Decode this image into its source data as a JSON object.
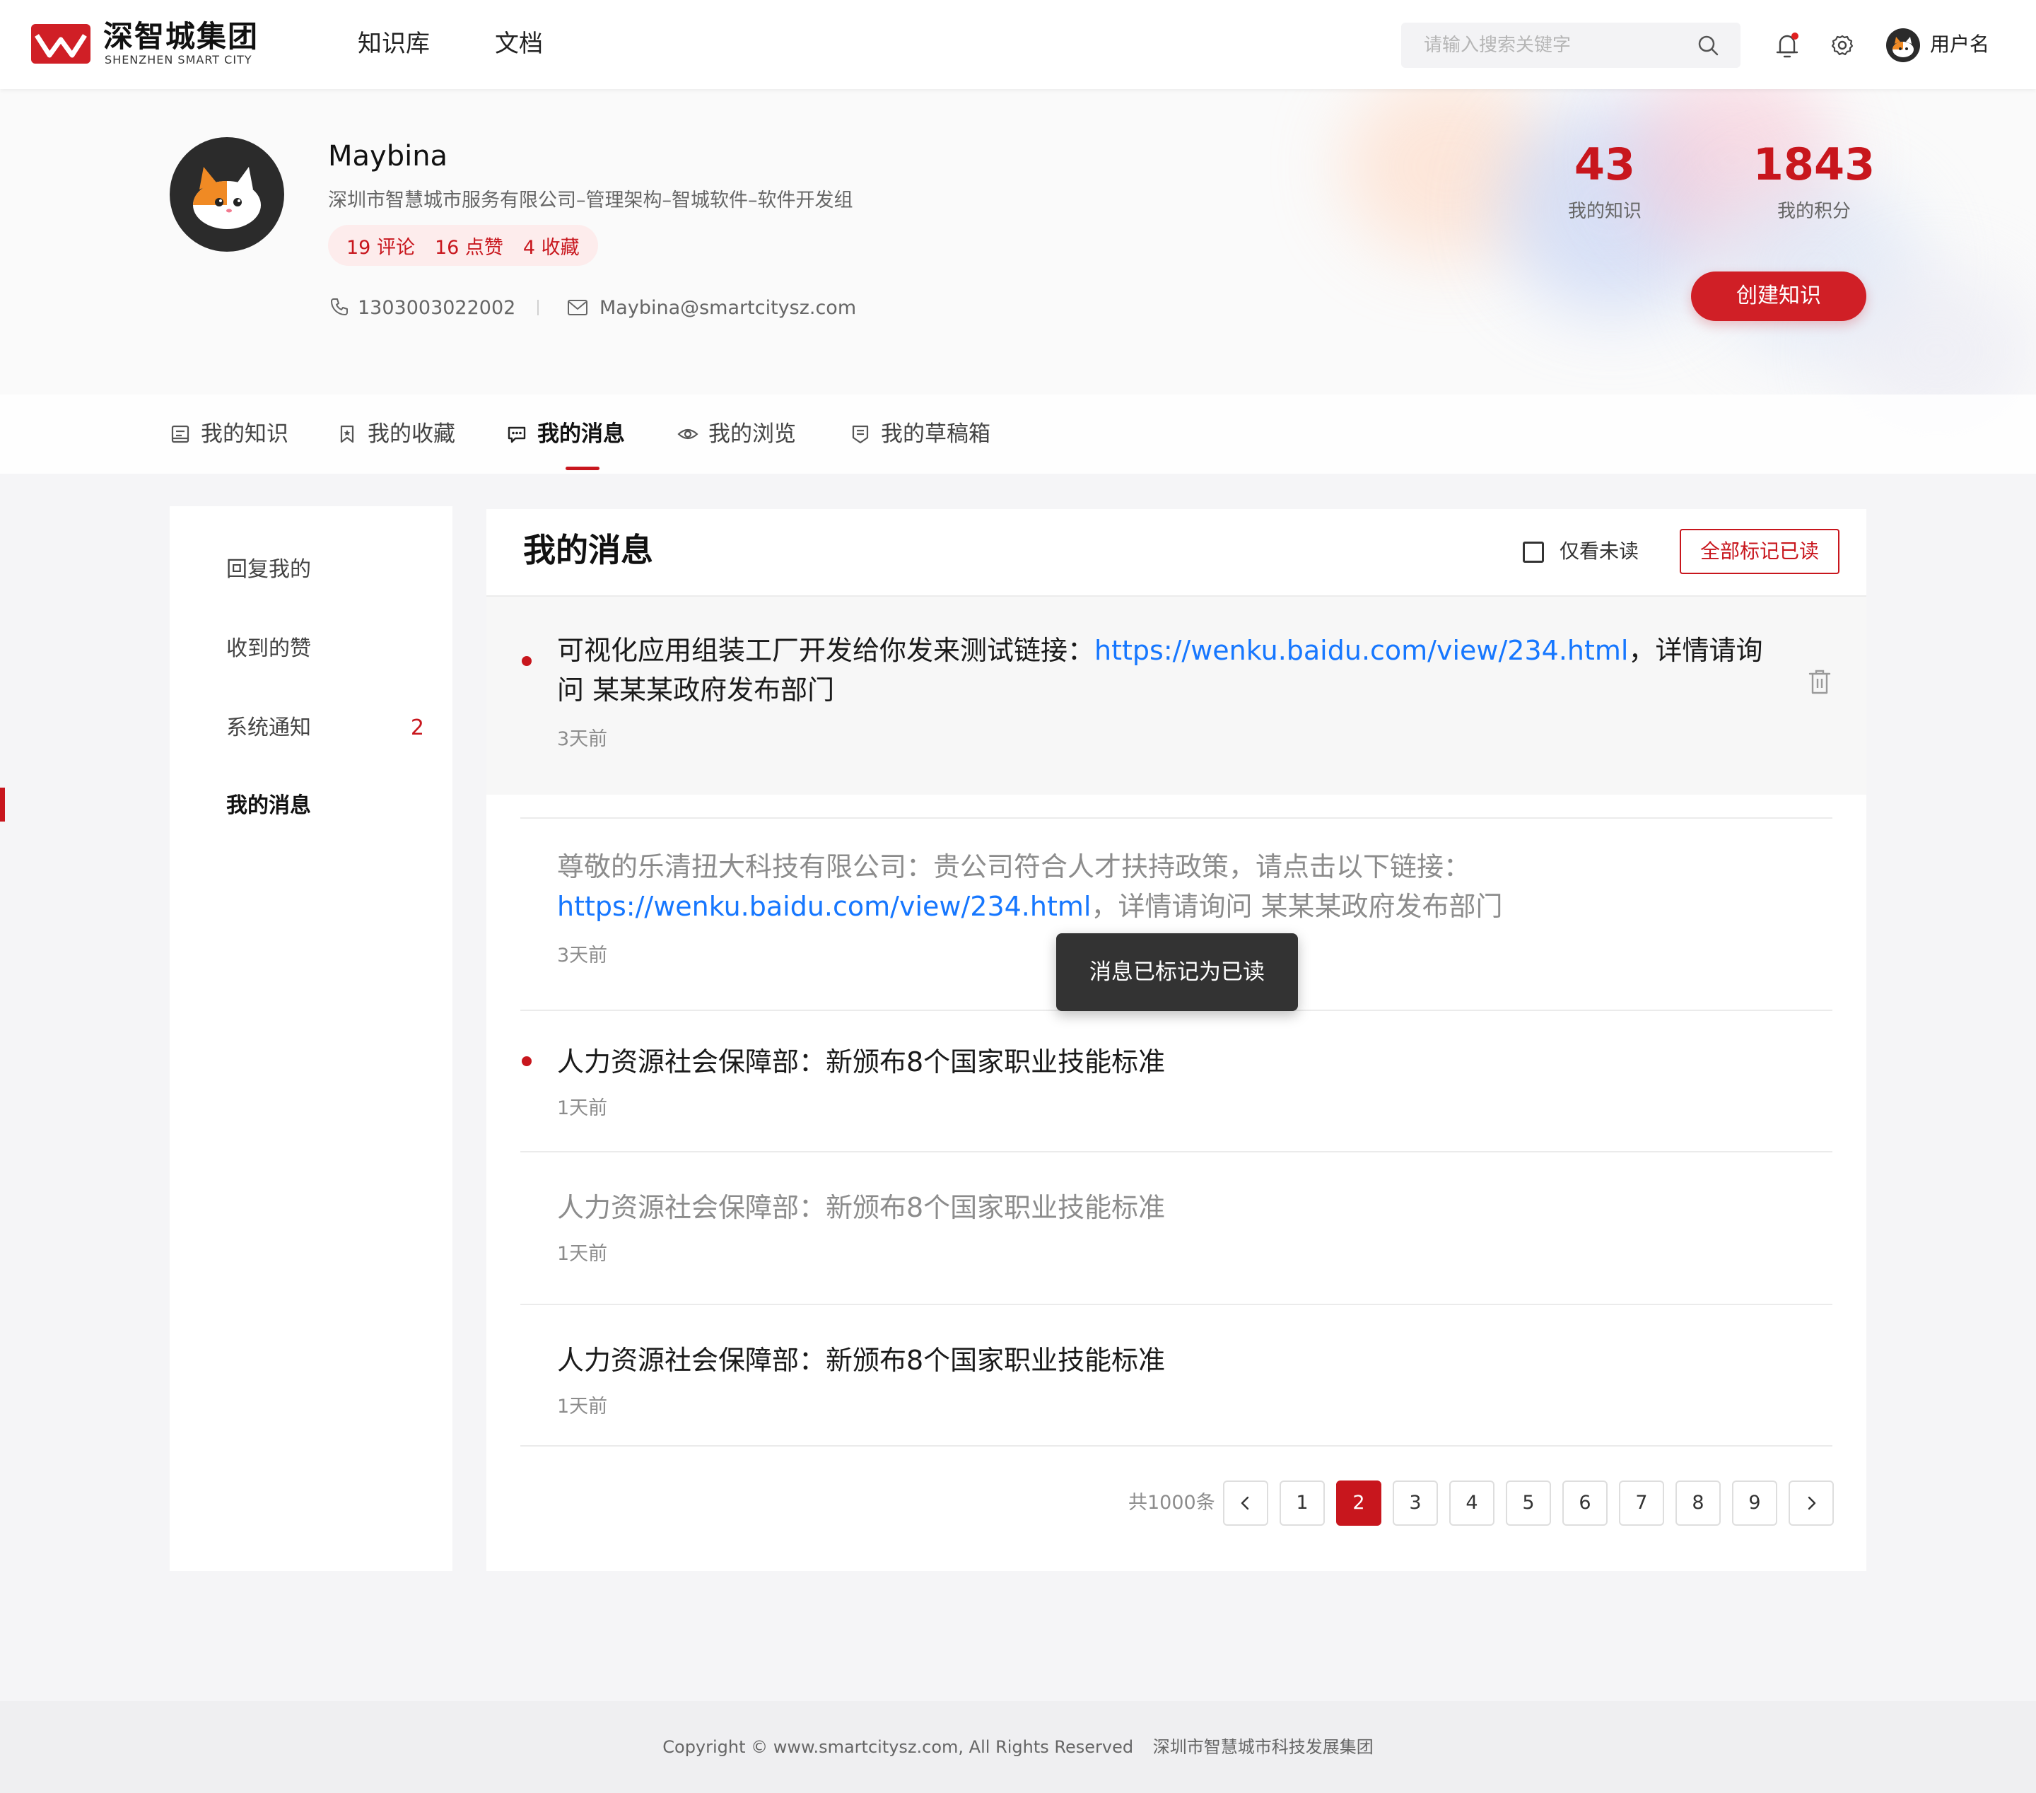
{
  "header": {
    "logo_cn": "深智城集团",
    "logo_en": "SHENZHEN SMART CITY",
    "nav": [
      "知识库",
      "文档"
    ],
    "search_placeholder": "请输入搜索关键字",
    "username": "用户名",
    "notification_dot_color": "#e02020"
  },
  "profile": {
    "name": "Maybina",
    "org": "深圳市智慧城市服务有限公司–管理架构–智城软件–软件开发组",
    "stats": {
      "comments": "19 评论",
      "likes": "16 点赞",
      "favorites": "4 收藏"
    },
    "phone": "1303003022002",
    "email": "Maybina@smartcitysz.com",
    "knowledge_count": "43",
    "knowledge_label": "我的知识",
    "points_count": "1843",
    "points_label": "我的积分",
    "create_button": "创建知识"
  },
  "tabs": [
    {
      "label": "我的知识",
      "icon": "book-icon"
    },
    {
      "label": "我的收藏",
      "icon": "bookmark-icon"
    },
    {
      "label": "我的消息",
      "icon": "message-icon",
      "active": true
    },
    {
      "label": "我的浏览",
      "icon": "eye-icon"
    },
    {
      "label": "我的草稿箱",
      "icon": "draft-icon"
    }
  ],
  "sidebar": {
    "items": [
      {
        "label": "回复我的"
      },
      {
        "label": "收到的赞"
      },
      {
        "label": "系统通知",
        "badge": "2"
      },
      {
        "label": "我的消息",
        "active": true
      }
    ]
  },
  "panel": {
    "title": "我的消息",
    "unread_only_label": "仅看未读",
    "mark_all_label": "全部标记已读",
    "toast": "消息已标记为已读",
    "messages": [
      {
        "text_before": "可视化应用组装工厂开发给你发来测试链接：",
        "link": "https://wenku.baidu.com/view/234.html",
        "text_after": "，详情请询问 某某某政府发布部门",
        "time": "3天前",
        "unread": true
      },
      {
        "text_before": "尊敬的乐清扭大科技有限公司：贵公司符合人才扶持政策，请点击以下链接：",
        "link": "https://wenku.baidu.com/view/234.html",
        "text_after": "，详情请询问 某某某政府发布部门",
        "time": "3天前",
        "unread": false
      },
      {
        "text": "人力资源社会保障部：新颁布8个国家职业技能标准",
        "time": "1天前",
        "unread": true
      },
      {
        "text": "人力资源社会保障部：新颁布8个国家职业技能标准",
        "time": "1天前",
        "unread": false
      },
      {
        "text": "人力资源社会保障部：新颁布8个国家职业技能标准",
        "time": "1天前",
        "unread": false
      }
    ]
  },
  "pagination": {
    "total": "共1000条",
    "pages": [
      "1",
      "2",
      "3",
      "4",
      "5",
      "6",
      "7",
      "8",
      "9"
    ],
    "current": "2"
  },
  "footer": {
    "copyright": "Copyright © www.smartcitysz.com, All Rights Reserved",
    "company": "深圳市智慧城市科技发展集团"
  },
  "colors": {
    "brand_red": "#c8161d",
    "link_blue": "#1677ff"
  }
}
